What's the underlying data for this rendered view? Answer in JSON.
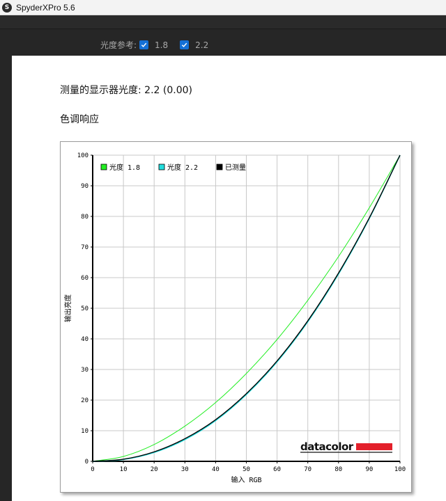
{
  "window": {
    "title": "SpyderXPro 5.6",
    "app_icon": "S"
  },
  "toolbar": {
    "gamma_label": "光度参考:",
    "options": [
      {
        "label": "1.8",
        "checked": true
      },
      {
        "label": "2.2",
        "checked": true
      }
    ]
  },
  "report": {
    "measured_gamma": "测量的显示器光度:  2.2 (0.00)",
    "section_title": "色调响应"
  },
  "chart_data": {
    "type": "line",
    "xlabel": "输入 RGB",
    "ylabel": "输出亮度",
    "xlim": [
      0,
      100
    ],
    "ylim": [
      0,
      100
    ],
    "xticks": [
      "0",
      "10",
      "20",
      "30",
      "40",
      "50",
      "60",
      "70",
      "80",
      "90",
      "100"
    ],
    "yticks": [
      "0",
      "10",
      "20",
      "30",
      "40",
      "50",
      "60",
      "70",
      "80",
      "90",
      "100"
    ],
    "grid": true,
    "legend_position": "top-left",
    "series": [
      {
        "name": "光度 1.8",
        "color": "#22ee22",
        "x": [
          0,
          10,
          20,
          30,
          40,
          50,
          60,
          70,
          80,
          90,
          100
        ],
        "y": [
          0,
          1.6,
          5.5,
          11.5,
          19.2,
          28.7,
          39.8,
          52.6,
          66.9,
          82.8,
          100
        ]
      },
      {
        "name": "光度 2.2",
        "color": "#22dddd",
        "x": [
          0,
          10,
          20,
          30,
          40,
          50,
          60,
          70,
          80,
          90,
          100
        ],
        "y": [
          0,
          0.6,
          2.9,
          7.1,
          13.3,
          21.8,
          32.5,
          45.6,
          61.2,
          79.3,
          100
        ]
      },
      {
        "name": "已测量",
        "color": "#000000",
        "x": [
          0,
          10,
          20,
          30,
          40,
          50,
          60,
          70,
          80,
          90,
          100
        ],
        "y": [
          0,
          0.7,
          3.1,
          7.4,
          13.6,
          22.1,
          32.8,
          45.9,
          61.5,
          79.5,
          100
        ]
      }
    ],
    "logo": "datacolor"
  }
}
